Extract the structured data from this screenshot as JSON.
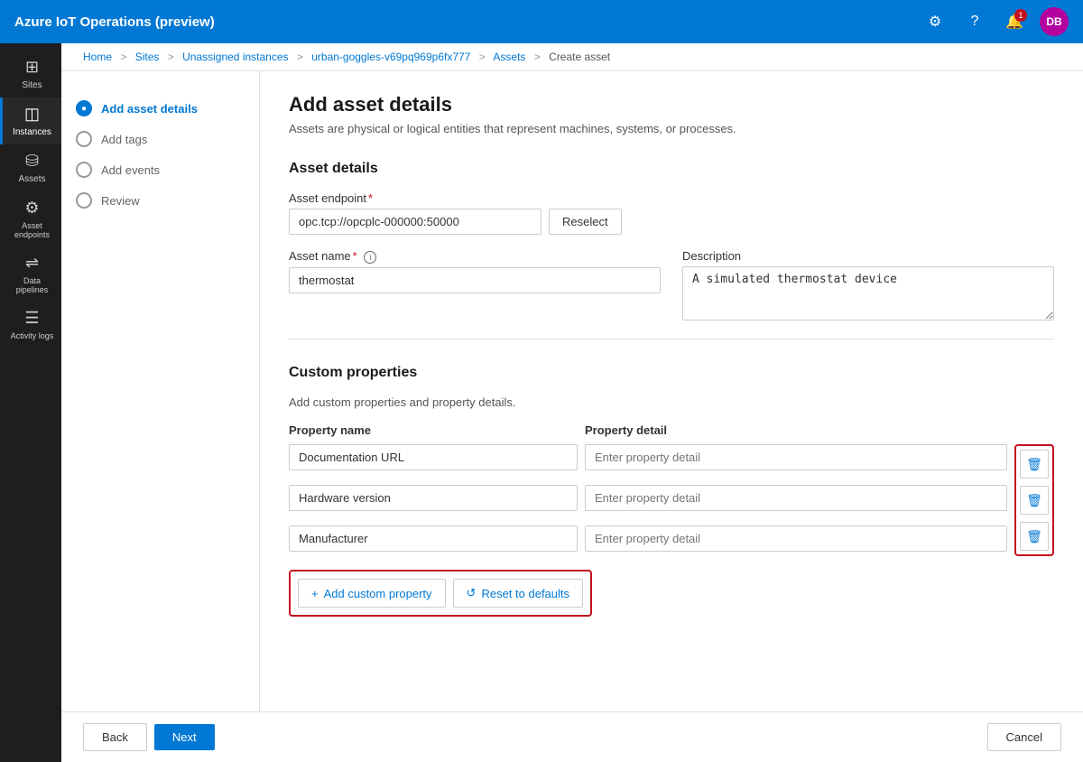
{
  "app": {
    "title": "Azure IoT Operations (preview)"
  },
  "topbar": {
    "title": "Azure IoT Operations (preview)",
    "notification_count": "1",
    "avatar_label": "DB"
  },
  "breadcrumb": {
    "items": [
      "Home",
      "Sites",
      "Unassigned instances",
      "urban-goggles-v69pq969p6fx777",
      "Assets",
      "Create asset"
    ]
  },
  "sidebar": {
    "items": [
      {
        "id": "sites",
        "label": "Sites",
        "icon": "⊞"
      },
      {
        "id": "instances",
        "label": "Instances",
        "icon": "◫"
      },
      {
        "id": "assets",
        "label": "Assets",
        "icon": "⛁"
      },
      {
        "id": "asset-endpoints",
        "label": "Asset endpoints",
        "icon": "⛭"
      },
      {
        "id": "data-pipelines",
        "label": "Data pipelines",
        "icon": "⇌"
      },
      {
        "id": "activity-logs",
        "label": "Activity logs",
        "icon": "☰"
      }
    ]
  },
  "wizard": {
    "steps": [
      {
        "id": "add-asset-details",
        "label": "Add asset details",
        "active": true
      },
      {
        "id": "add-tags",
        "label": "Add tags",
        "active": false
      },
      {
        "id": "add-events",
        "label": "Add events",
        "active": false
      },
      {
        "id": "review",
        "label": "Review",
        "active": false
      }
    ]
  },
  "form": {
    "page_title": "Add asset details",
    "page_subtitle": "Assets are physical or logical entities that represent machines, systems, or processes.",
    "asset_details_title": "Asset details",
    "asset_endpoint_label": "Asset endpoint",
    "asset_endpoint_value": "opc.tcp://opcplc-000000:50000",
    "reselect_label": "Reselect",
    "asset_name_label": "Asset name",
    "asset_name_value": "thermostat",
    "description_label": "Description",
    "description_value": "A simulated thermostat device",
    "custom_props_title": "Custom properties",
    "custom_props_subtitle": "Add custom properties and property details.",
    "property_name_header": "Property name",
    "property_detail_header": "Property detail",
    "properties": [
      {
        "name": "Documentation URL",
        "detail": "",
        "detail_placeholder": "Enter property detail"
      },
      {
        "name": "Hardware version",
        "detail": "",
        "detail_placeholder": "Enter property detail"
      },
      {
        "name": "Manufacturer",
        "detail": "",
        "detail_placeholder": "Enter property detail"
      }
    ],
    "add_custom_property_label": "Add custom property",
    "reset_to_defaults_label": "Reset to defaults"
  },
  "footer": {
    "back_label": "Back",
    "next_label": "Next",
    "cancel_label": "Cancel"
  }
}
